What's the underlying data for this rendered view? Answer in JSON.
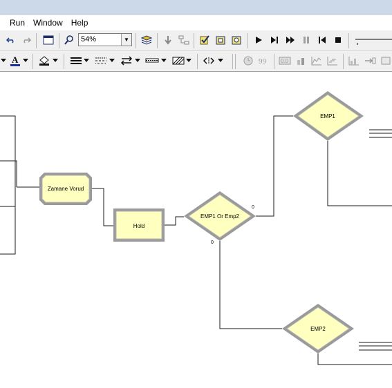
{
  "menu": {
    "items": [
      "Run",
      "Window",
      "Help"
    ]
  },
  "toolbar": {
    "zoom_value": "54%"
  },
  "modules": {
    "process": {
      "label": "Zamane Vorud"
    },
    "hold": {
      "label": "Hold"
    },
    "decide_main": {
      "label": "EMP1 Or Emp2",
      "true_branch": "0",
      "false_branch": "0"
    },
    "emp1": {
      "label": "EMP1"
    },
    "emp2": {
      "label": "EMP2"
    }
  },
  "colors": {
    "module_fill": "#ffffc0",
    "module_border": "#8c8c8c",
    "menubar_tint": "#ccd9e8",
    "toolbar_bg": "#f0f0f0"
  }
}
